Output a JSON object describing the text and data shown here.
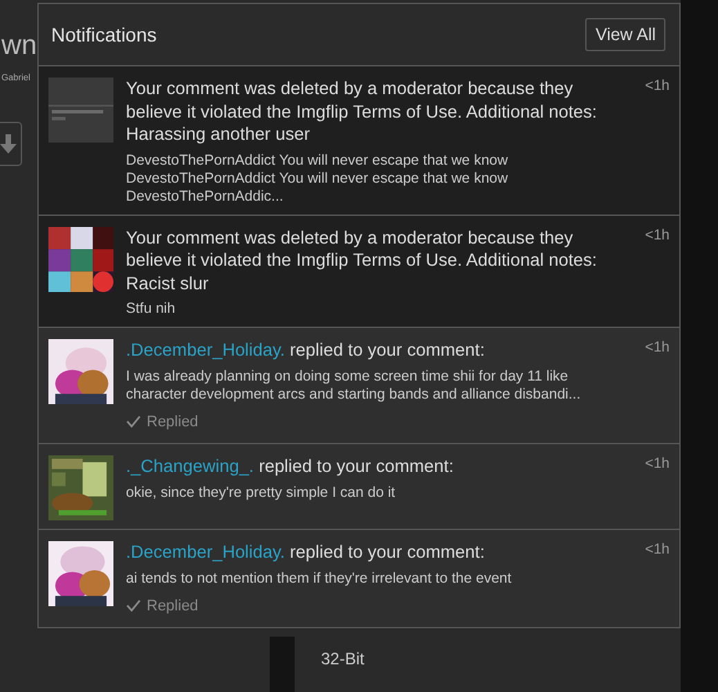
{
  "background_page": {
    "heading": "wn",
    "username": "Gabriel",
    "label": "32-Bit"
  },
  "notifications": {
    "title": "Notifications",
    "view_all": "View All",
    "items": [
      {
        "kind": "moderation",
        "message": "Your comment was deleted by a moderator because they believe it violated the Imgflip Terms of Use. Additional notes: Harassing another user",
        "text": "DevestoThePornAddict You will never escape that we know DevestoThePornAddict You will never escape that we know DevestoThePornAddic...",
        "time": "<1h"
      },
      {
        "kind": "moderation",
        "message": "Your comment was deleted by a moderator because they believe it violated the Imgflip Terms of Use. Additional notes: Racist slur",
        "text": "Stfu nih",
        "time": "<1h"
      },
      {
        "kind": "reply",
        "user": ".December_Holiday.",
        "action": "replied to your comment:",
        "text": "I was already planning on doing some screen time shii for day 11 like character development arcs and starting bands and alliance disbandi...",
        "time": "<1h",
        "replied": true,
        "status": "Replied"
      },
      {
        "kind": "reply",
        "user": "._Changewing_.",
        "action": "replied to your comment:",
        "text": "okie, since they're pretty simple I can do it",
        "time": "<1h",
        "replied": false
      },
      {
        "kind": "reply",
        "user": ".December_Holiday.",
        "action": "replied to your comment:",
        "text": "ai tends to not mention them if they're irrelevant to the event",
        "time": "<1h",
        "replied": true,
        "status": "Replied"
      }
    ]
  }
}
